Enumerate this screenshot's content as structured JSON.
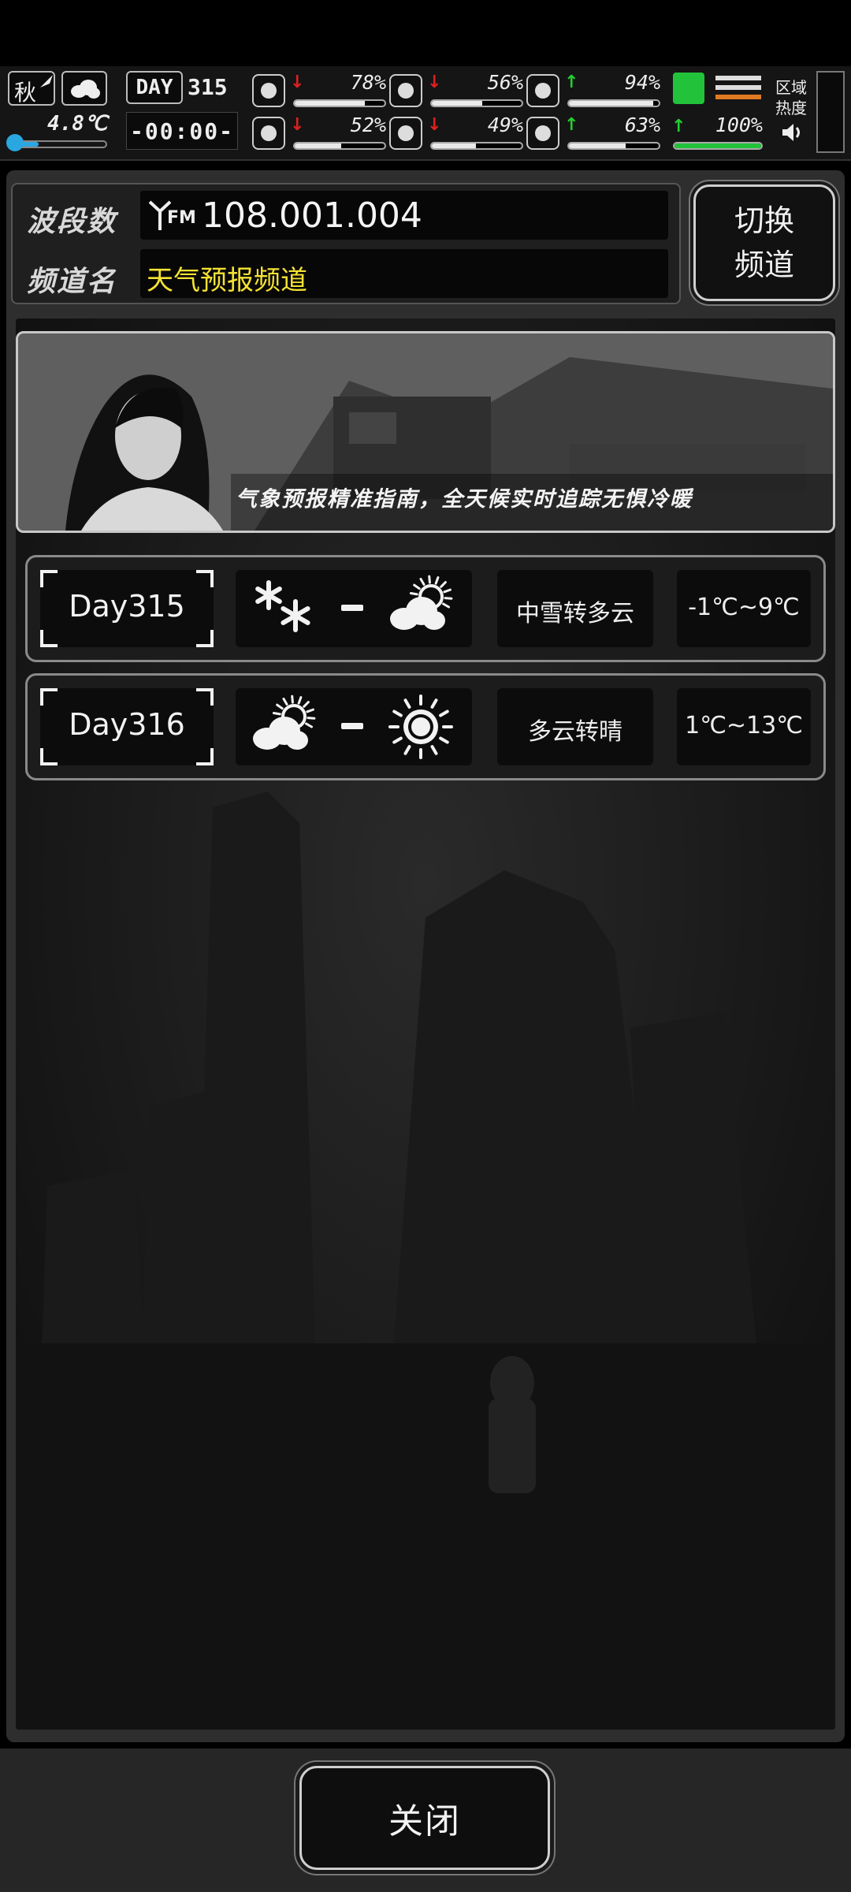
{
  "hud": {
    "season": "秋",
    "temperature": "4.8℃",
    "day_label": "DAY",
    "day_number": "315",
    "clock": "-00:00-",
    "stats": [
      {
        "name": "health",
        "icon": "first-aid-icon",
        "trend": "down",
        "trend_arrow": "↓",
        "percent_text": "78%",
        "value": 0.78
      },
      {
        "name": "hunger",
        "icon": "stomach-icon",
        "trend": "down",
        "trend_arrow": "↓",
        "percent_text": "56%",
        "value": 0.56
      },
      {
        "name": "medicine",
        "icon": "pill-icon",
        "trend": "up",
        "trend_arrow": "↑",
        "percent_text": "94%",
        "value": 0.94
      },
      {
        "name": "mental",
        "icon": "brain-icon",
        "trend": "down",
        "trend_arrow": "↓",
        "percent_text": "52%",
        "value": 0.52
      },
      {
        "name": "thirst",
        "icon": "water-drop-icon",
        "trend": "down",
        "trend_arrow": "↓",
        "percent_text": "49%",
        "value": 0.49
      },
      {
        "name": "mood",
        "icon": "heart-icon",
        "trend": "up",
        "trend_arrow": "↑",
        "percent_text": "63%",
        "value": 0.63
      }
    ],
    "stamina": {
      "trend_arrow": "↑",
      "percent_text": "100%",
      "value": 1.0
    },
    "region_heat": "区域\n热度",
    "colors": {
      "down": "#e02020",
      "up": "#22d030",
      "stamina": "#22c33a",
      "temp_bar": "#2aa7e0"
    }
  },
  "radio": {
    "band_label": "波段数",
    "band_value": "108.001.004",
    "fm_tag": "FM",
    "channel_label": "频道名",
    "channel_value": "天气预报频道",
    "channel_color": "#f4e233",
    "switch_button": "切换\n频道"
  },
  "banner": {
    "slogan": "气象预报精准指南，全天候实时追踪无惧冷暖"
  },
  "forecast": [
    {
      "day": "Day315",
      "icon_from": "snow-icon",
      "icon_to": "partly-cloudy-icon",
      "description": "中雪转多云",
      "temperature": "-1℃~9℃"
    },
    {
      "day": "Day316",
      "icon_from": "partly-cloudy-icon",
      "icon_to": "sun-icon",
      "description": "多云转晴",
      "temperature": "1℃~13℃"
    }
  ],
  "footer": {
    "close_button": "关闭"
  }
}
